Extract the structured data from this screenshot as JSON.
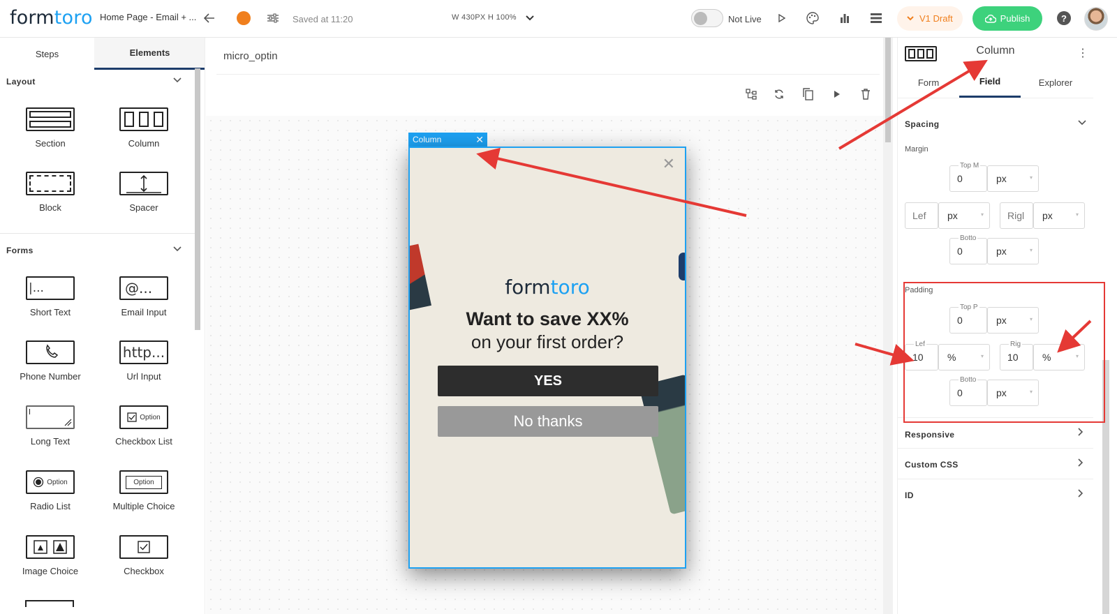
{
  "topbar": {
    "logo_a": "form",
    "logo_b": "toro",
    "breadcrumb": "Home Page - Email + ...",
    "saved_text": "Saved at 11:20",
    "dimensions": "W 430PX  H 100%",
    "live_status": "Not Live",
    "draft_label": "V1 Draft",
    "publish_label": "Publish",
    "help_label": "?"
  },
  "left_panel": {
    "tabs": [
      "Steps",
      "Elements"
    ],
    "layout_header": "Layout",
    "layout_items": [
      "Section",
      "Column",
      "Block",
      "Spacer"
    ],
    "forms_header": "Forms",
    "form_items": [
      "Short Text",
      "Email Input",
      "Phone Number",
      "Url Input",
      "Long Text",
      "Checkbox List",
      "Radio List",
      "Multiple Choice",
      "Image Choice",
      "Checkbox"
    ],
    "icon_texts": {
      "short_text": "|...",
      "email": "@...",
      "url": "http...",
      "option": "Option"
    }
  },
  "canvas": {
    "title": "micro_optin",
    "column_tag": "Column"
  },
  "popup": {
    "logo_a": "form",
    "logo_b": "toro",
    "headline": "Want to save XX%",
    "subline": "on your first order?",
    "yes_label": "YES",
    "no_label": "No thanks"
  },
  "right_panel": {
    "title": "Column",
    "tabs": [
      "Form",
      "Field",
      "Explorer"
    ],
    "spacing_header": "Spacing",
    "margin_label": "Margin",
    "margin": {
      "top_label": "Top M",
      "top_value": "0",
      "top_unit": "px",
      "left_label": "Lef",
      "left_value": "",
      "left_unit": "px",
      "right_label": "Rigl",
      "right_value": "",
      "right_unit": "px",
      "bottom_label": "Botto",
      "bottom_value": "0",
      "bottom_unit": "px"
    },
    "padding_label": "Padding",
    "padding": {
      "top_label": "Top P",
      "top_value": "0",
      "top_unit": "px",
      "left_label": "Lef",
      "left_value": "10",
      "left_unit": "%",
      "right_label": "Rig",
      "right_value": "10",
      "right_unit": "%",
      "bottom_label": "Botto",
      "bottom_value": "0",
      "bottom_unit": "px"
    },
    "sections": [
      "Responsive",
      "Custom CSS",
      "ID"
    ]
  },
  "colors": {
    "accent_blue": "#1da1f2",
    "publish_green": "#3dd27c",
    "draft_orange": "#f07f1d",
    "annotation_red": "#e53935"
  }
}
